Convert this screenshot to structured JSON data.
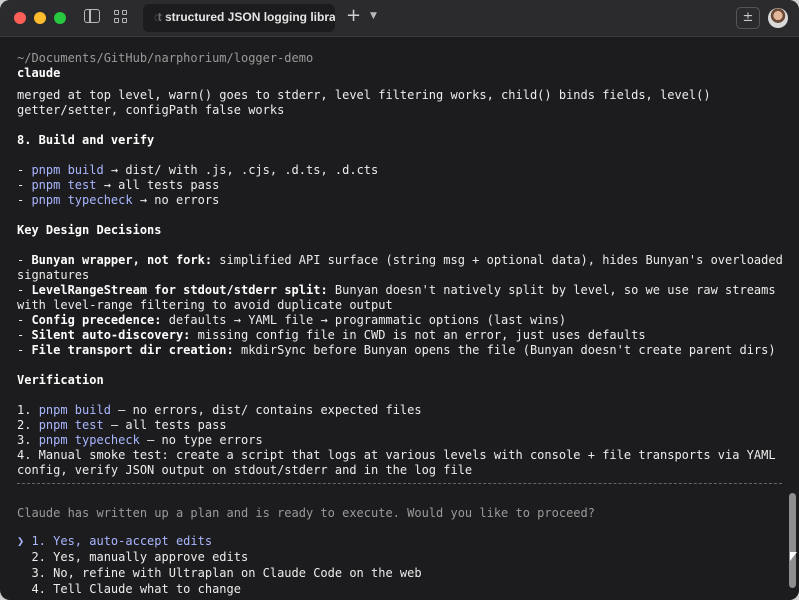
{
  "window": {
    "tab_title": "xt structured JSON logging library",
    "new_tab_glyph": "+",
    "tab_menu_glyph": "⌄",
    "export_glyph": "±"
  },
  "terminal": {
    "cwd": "~/Documents/GitHub/narphorium/logger-demo",
    "program": "claude",
    "lines": {
      "l1": "merged at top level, warn() goes to stderr, level filtering works, child() binds fields, level()",
      "l2": "getter/setter, configPath false works",
      "h_build": "8. Build and verify",
      "b1_cmd": "pnpm build",
      "b1_rest": " → dist/ with .js, .cjs, .d.ts, .d.cts",
      "b2_cmd": "pnpm test",
      "b2_rest": " → all tests pass",
      "b3_cmd": "pnpm typecheck",
      "b3_rest": " → no errors",
      "h_design": "Key Design Decisions",
      "d1_bold": "Bunyan wrapper, not fork:",
      "d1_rest": " simplified API surface (string msg + optional data), hides Bunyan's overloaded",
      "d1_cont": "signatures",
      "d2_bold": "LevelRangeStream for stdout/stderr split:",
      "d2_rest": " Bunyan doesn't natively split by level, so we use raw streams",
      "d2_cont": "with level-range filtering to avoid duplicate output",
      "d3_bold": "Config precedence:",
      "d3_rest": " defaults → YAML file → programmatic options (last wins)",
      "d4_bold": "Silent auto-discovery:",
      "d4_rest": " missing config file in CWD is not an error, just uses defaults",
      "d5_bold": "File transport dir creation:",
      "d5_rest": " mkdirSync before Bunyan opens the file (Bunyan doesn't create parent dirs)",
      "h_verify": "Verification",
      "v1_cmd": "pnpm build",
      "v1_rest": " — no errors, dist/ contains expected files",
      "v2_cmd": "pnpm test",
      "v2_rest": " — all tests pass",
      "v3_cmd": "pnpm typecheck",
      "v3_rest": " — no type errors",
      "v4": "4. Manual smoke test: create a script that logs at various levels with console + file transports via YAML",
      "v4_cont": "config, verify JSON output on stdout/stderr and in the log file"
    },
    "prompt": "Claude has written up a plan and is ready to execute. Would you like to proceed?",
    "options": [
      "❯ 1. Yes, auto-accept edits",
      "  2. Yes, manually approve edits",
      "  3. No, refine with Ultraplan on Claude Code on the web",
      "  4. Tell Claude what to change"
    ]
  }
}
